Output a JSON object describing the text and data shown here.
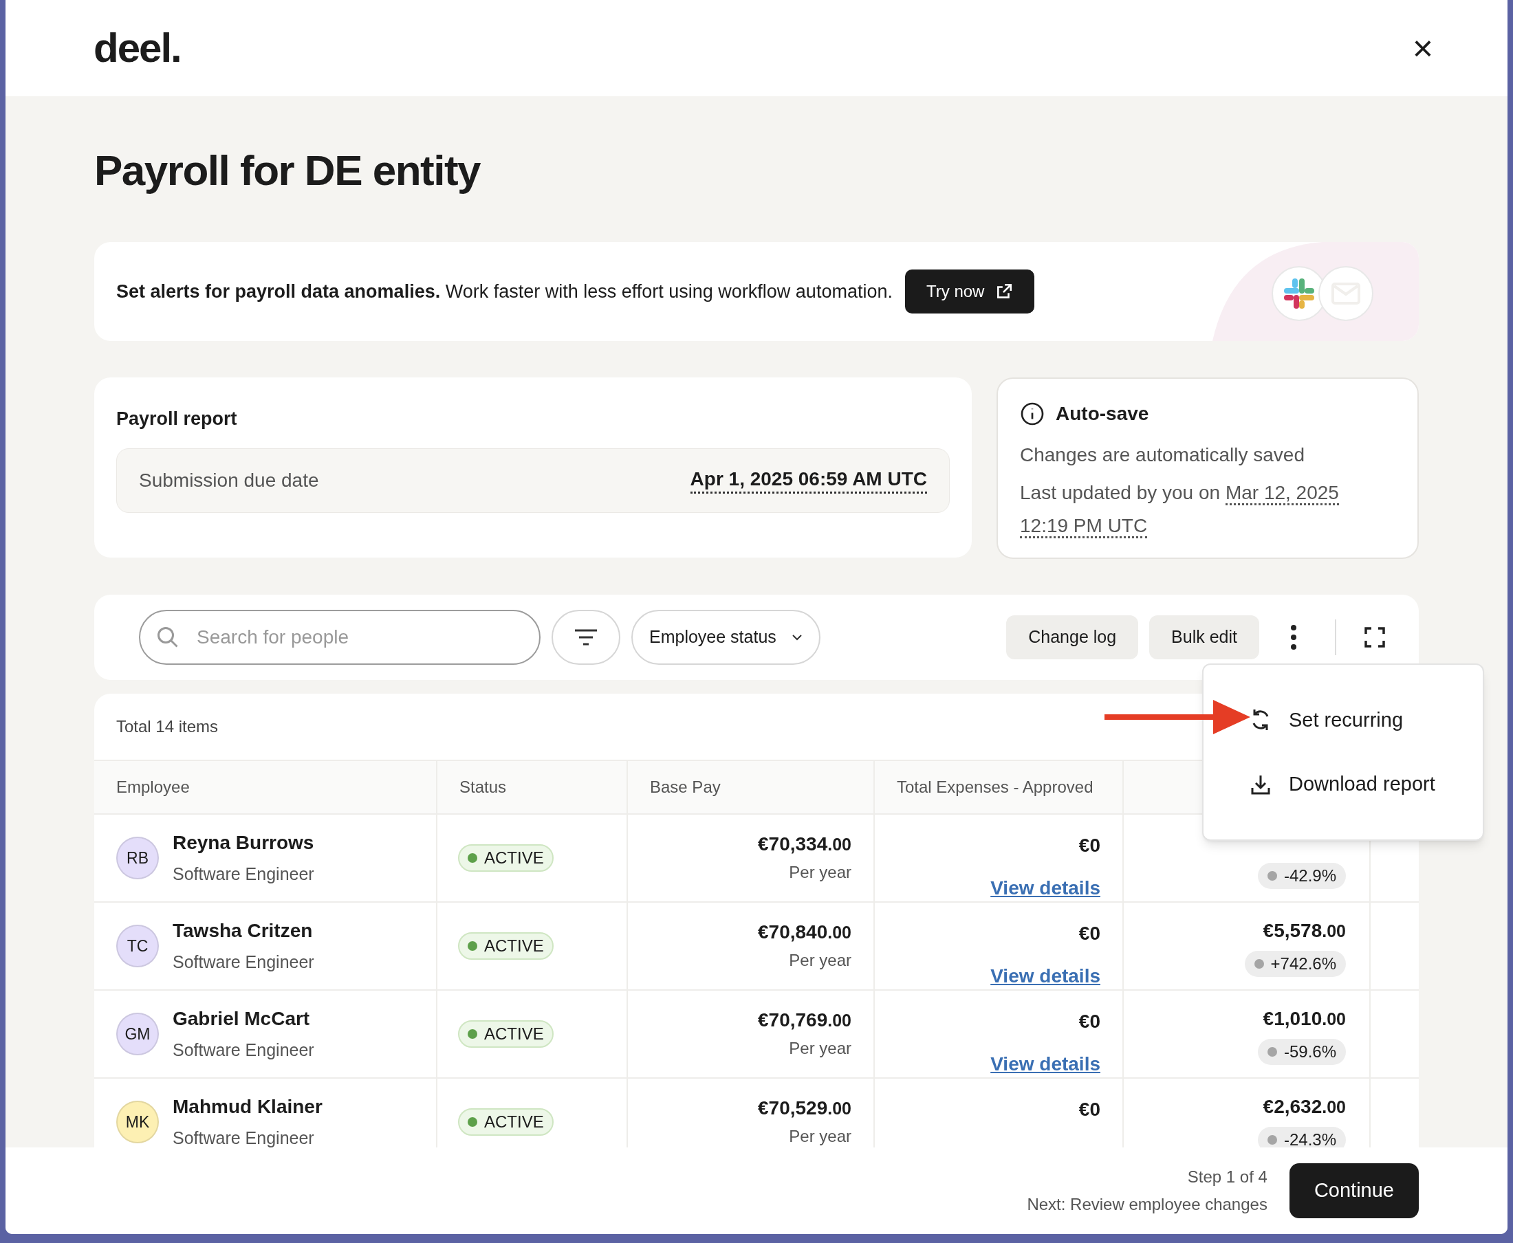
{
  "header": {
    "logo": "deel.",
    "close": "×"
  },
  "title": "Payroll for DE entity",
  "banner": {
    "text": "**Set alerts for payroll data anomalies.** Work faster with less effort using workflow automation.",
    "button": "Try now"
  },
  "report": {
    "title": "Payroll report",
    "due_label": "Submission due date",
    "due_value": "Apr 1, 2025 06:59 AM UTC"
  },
  "autosave": {
    "title": "Auto-save",
    "line1": "Changes are automatically saved",
    "line2": "Last updated by you on",
    "date": "Mar 12, 2025",
    "time": "12:19 PM UTC"
  },
  "toolbar": {
    "search": {
      "placeholder": "Search for people"
    },
    "status_filter": "Employee status",
    "buttons": [
      "Change log",
      "Bulk edit"
    ]
  },
  "menu": {
    "items": [
      {
        "kind": "recurring",
        "label": "Set recurring"
      },
      {
        "kind": "download",
        "label": "Download report"
      }
    ]
  },
  "table": {
    "total": "Total 14 items",
    "columns": [
      "Employee",
      "Status",
      "Base Pay",
      "Total Expenses - Approved"
    ],
    "rows": [
      {
        "initials": "RB",
        "color": "#e4defa",
        "name": "Reyna Burrows",
        "role": "Software Engineer",
        "status": "ACTIVE",
        "pay": "€70,334",
        "cents": ".00",
        "period": "Per year",
        "expenses": "€0",
        "link": "View details",
        "change": "-42.9%"
      },
      {
        "initials": "TC",
        "color": "#e4defa",
        "name": "Tawsha Critzen",
        "role": "Software Engineer",
        "status": "ACTIVE",
        "pay": "€70,840",
        "cents": ".00",
        "period": "Per year",
        "expenses": "€0",
        "link": "View details",
        "amount": "€5,578",
        "amount_cents": ".00",
        "change": "+742.6%"
      },
      {
        "initials": "GM",
        "color": "#e4defa",
        "name": "Gabriel McCart",
        "role": "Software Engineer",
        "status": "ACTIVE",
        "pay": "€70,769",
        "cents": ".00",
        "period": "Per year",
        "expenses": "€0",
        "link": "View details",
        "amount": "€1,010",
        "amount_cents": ".00",
        "change": "-59.6%"
      },
      {
        "initials": "MK",
        "color": "#fdf0b3",
        "name": "Mahmud Klainer",
        "role": "Software Engineer",
        "status": "ACTIVE",
        "pay": "€70,529",
        "cents": ".00",
        "period": "Per year",
        "expenses": "€0",
        "amount": "€2,632",
        "amount_cents": ".00",
        "change": "-24.3%"
      }
    ]
  },
  "footer": {
    "step": "Step 1 of 4",
    "next": "Next: Review employee changes",
    "button": "Continue"
  }
}
